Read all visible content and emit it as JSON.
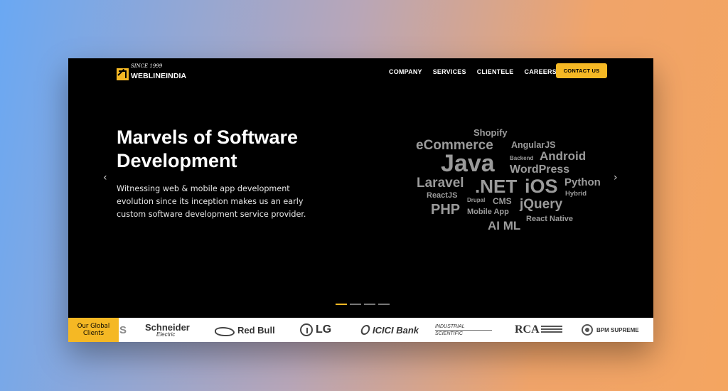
{
  "header": {
    "logo_since": "SINCE 1999",
    "logo_name": "WEBLINEINDIA",
    "nav": [
      "COMPANY",
      "SERVICES",
      "CLIENTELE",
      "CAREERS"
    ],
    "contact": "CONTACT US"
  },
  "hero": {
    "title": "Marvels of Software Development",
    "description": "Witnessing web & mobile app development evolution since its inception makes us an early custom software development service provider.",
    "prev_arrow": "‹",
    "next_arrow": "›"
  },
  "tags": [
    "Shopify",
    "eCommerce",
    "AngularJS",
    "Java",
    "Backend",
    "Android",
    "WordPress",
    "Laravel",
    ".NET",
    "iOS",
    "Python",
    "ReactJS",
    "Hybrid",
    "Drupal",
    "CMS",
    "PHP",
    "jQuery",
    "Mobile App",
    "AI ML",
    "React Native"
  ],
  "carousel": {
    "slides": 4,
    "active": 0
  },
  "clients": {
    "label": "Our Global Clients",
    "partial": "S",
    "schneider_1": "Schneider",
    "schneider_2": "Electric",
    "redbull": "Red Bull",
    "lg": "LG",
    "icici": "ICICI Bank",
    "industrial_1": "INDUSTRIAL",
    "industrial_2": "SCIENTIFIC",
    "rca": "RCA",
    "bpm": "BPM SUPREME"
  },
  "colors": {
    "accent": "#f5b824",
    "background": "#000000",
    "tag": "#9b9b9b"
  }
}
